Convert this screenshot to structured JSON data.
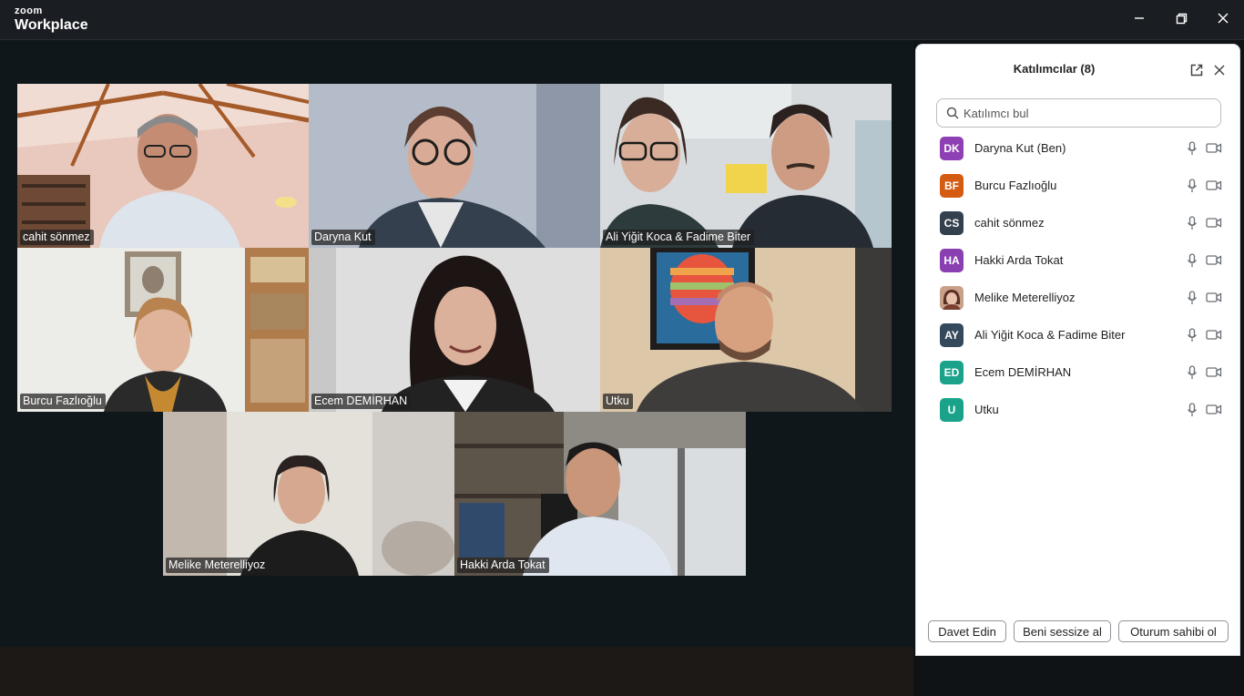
{
  "app": {
    "brand_top": "zoom",
    "brand_bottom": "Workplace"
  },
  "tiles": [
    {
      "name": "cahit sönmez",
      "active": true
    },
    {
      "name": "Daryna Kut"
    },
    {
      "name": "Ali Yiğit Koca & Fadime Biter"
    },
    {
      "name": "Burcu Fazlıoğlu"
    },
    {
      "name": "Ecem DEMİRHAN"
    },
    {
      "name": "Utku"
    },
    {
      "name": "Melike Meterelliyoz"
    },
    {
      "name": "Hakki Arda Tokat"
    }
  ],
  "panel": {
    "title": "Katılımcılar (8)",
    "search_placeholder": "Katılımcı bul",
    "participants": [
      {
        "initials": "DK",
        "name": "Daryna Kut (Ben)",
        "color": "#8e3fb3"
      },
      {
        "initials": "BF",
        "name": "Burcu Fazlıoğlu",
        "color": "#d45b12"
      },
      {
        "initials": "CS",
        "name": "cahit sönmez",
        "color": "#33414e"
      },
      {
        "initials": "HA",
        "name": "Hakki Arda Tokat",
        "color": "#8a3fb0"
      },
      {
        "initials": "",
        "name": "Melike Meterelliyoz",
        "color": "#c9a08a",
        "photo": true
      },
      {
        "initials": "AY",
        "name": "Ali Yiğit Koca & Fadime Biter",
        "color": "#34495c"
      },
      {
        "initials": "ED",
        "name": "Ecem DEMİRHAN",
        "color": "#1aa38a"
      },
      {
        "initials": "U",
        "name": "Utku",
        "color": "#1aa38a"
      }
    ],
    "buttons": {
      "invite": "Davet Edin",
      "mute_me": "Beni sessize al",
      "host": "Oturum sahibi ol"
    }
  },
  "colors": {
    "active_speaker": "#34d27a"
  }
}
